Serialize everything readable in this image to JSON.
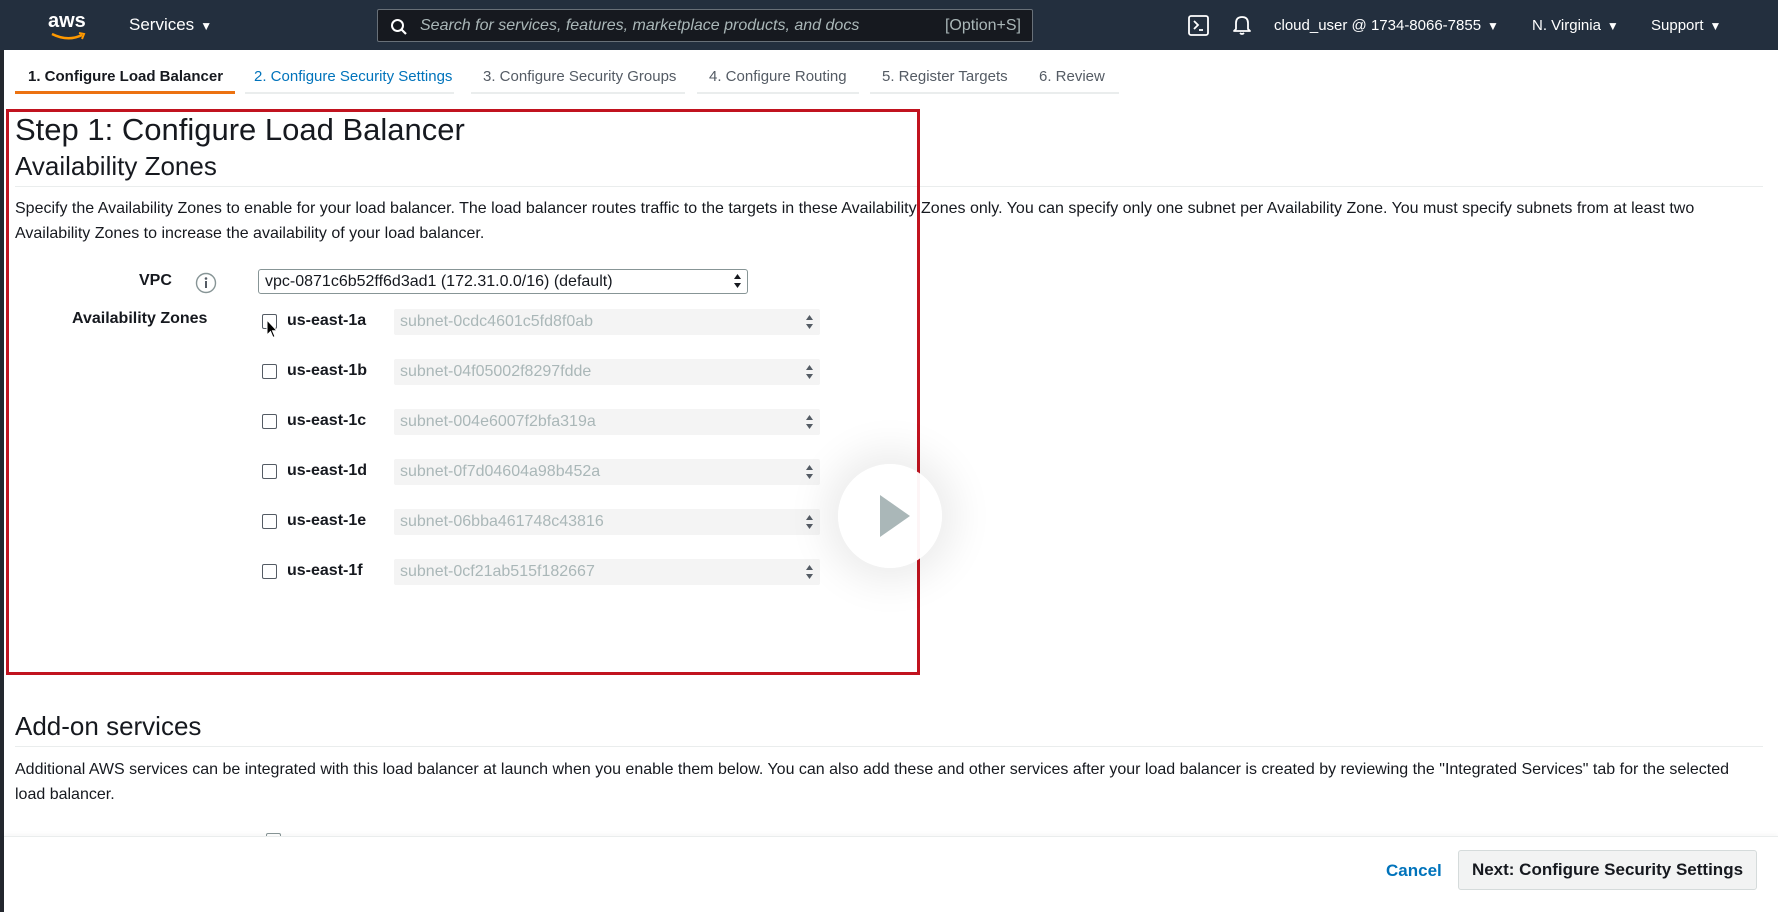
{
  "nav": {
    "logo": "aws",
    "services": "Services",
    "search_placeholder": "Search for services, features, marketplace products, and docs",
    "search_shortcut": "[Option+S]",
    "account": "cloud_user @ 1734-8066-7855",
    "region": "N. Virginia",
    "support": "Support"
  },
  "wizard_tabs": [
    {
      "label": "1. Configure Load Balancer",
      "state": "active"
    },
    {
      "label": "2. Configure Security Settings",
      "state": "link"
    },
    {
      "label": "3. Configure Security Groups",
      "state": "default"
    },
    {
      "label": "4. Configure Routing",
      "state": "default"
    },
    {
      "label": "5. Register Targets",
      "state": "default"
    },
    {
      "label": "6. Review",
      "state": "default"
    }
  ],
  "page": {
    "title": "Step 1: Configure Load Balancer",
    "az_section": {
      "heading": "Availability Zones",
      "description": "Specify the Availability Zones to enable for your load balancer. The load balancer routes traffic to the targets in these Availability Zones only. You can specify only one subnet per Availability Zone. You must specify subnets from at least two Availability Zones to increase the availability of your load balancer.",
      "vpc_label": "VPC",
      "vpc_value": "vpc-0871c6b52ff6d3ad1 (172.31.0.0/16) (default)",
      "az_label": "Availability Zones",
      "zones": [
        {
          "name": "us-east-1a",
          "subnet": "subnet-0cdc4601c5fd8f0ab",
          "checked": false
        },
        {
          "name": "us-east-1b",
          "subnet": "subnet-04f05002f8297fdde",
          "checked": false
        },
        {
          "name": "us-east-1c",
          "subnet": "subnet-004e6007f2bfa319a",
          "checked": false
        },
        {
          "name": "us-east-1d",
          "subnet": "subnet-0f7d04604a98b452a",
          "checked": false
        },
        {
          "name": "us-east-1e",
          "subnet": "subnet-06bba461748c43816",
          "checked": false
        },
        {
          "name": "us-east-1f",
          "subnet": "subnet-0cf21ab515f182667",
          "checked": false
        }
      ]
    },
    "addon_section": {
      "heading": "Add-on services",
      "description": "Additional AWS services can be integrated with this load balancer at launch when you enable them below. You can also add these and other services after your load balancer is created by reviewing the \"Integrated Services\" tab for the selected load balancer."
    }
  },
  "footer": {
    "cancel": "Cancel",
    "next": "Next: Configure Security Settings"
  },
  "colors": {
    "nav_bg": "#232f3e",
    "active_tab_underline": "#ec7211",
    "link": "#0073bb",
    "highlight_frame": "#c1131f"
  }
}
